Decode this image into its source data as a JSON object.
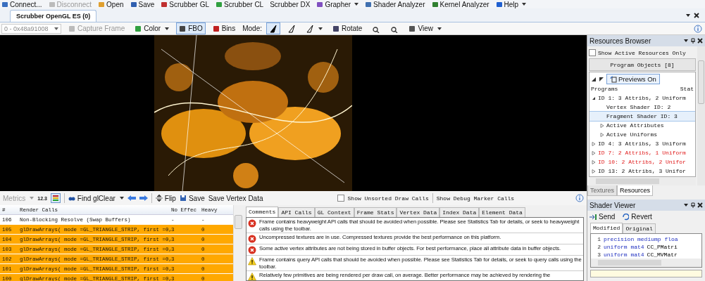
{
  "main_toolbar": [
    {
      "label": "Connect...",
      "disabled": false,
      "dropdown": false
    },
    {
      "label": "Disconnect",
      "disabled": true,
      "dropdown": false
    },
    {
      "label": "Open",
      "disabled": false,
      "dropdown": false
    },
    {
      "label": "Save",
      "disabled": false,
      "dropdown": false
    },
    {
      "label": "Scrubber GL",
      "disabled": false,
      "dropdown": false
    },
    {
      "label": "Scrubber CL",
      "disabled": false,
      "dropdown": false
    },
    {
      "label": "Scrubber DX",
      "disabled": false,
      "dropdown": false
    },
    {
      "label": "Grapher",
      "disabled": false,
      "dropdown": true
    },
    {
      "label": "Shader Analyzer",
      "disabled": false,
      "dropdown": false
    },
    {
      "label": "Kernel Analyzer",
      "disabled": false,
      "dropdown": false
    },
    {
      "label": "Help",
      "disabled": false,
      "dropdown": true
    }
  ],
  "document_tab": {
    "label": "Scrubber OpenGL ES (0)",
    "selected": true
  },
  "view_toolbar": {
    "frame": "0 - 0x48a91008",
    "items": [
      {
        "kind": "button",
        "label": "Capture Frame",
        "disabled": true,
        "pressed": false,
        "dropdown": false
      },
      {
        "kind": "button",
        "label": "Color",
        "disabled": false,
        "pressed": false,
        "dropdown": true
      },
      {
        "kind": "button",
        "label": "FBO",
        "disabled": false,
        "pressed": true,
        "dropdown": false
      },
      {
        "kind": "button",
        "label": "Bins",
        "disabled": false,
        "pressed": false,
        "dropdown": false
      },
      {
        "kind": "label",
        "label": "Mode:"
      },
      {
        "kind": "mode",
        "pressed": true,
        "dropdown": false
      },
      {
        "kind": "mode",
        "pressed": false,
        "dropdown": false
      },
      {
        "kind": "mode",
        "pressed": false,
        "dropdown": true
      },
      {
        "kind": "button",
        "label": "Rotate",
        "disabled": false,
        "pressed": false,
        "dropdown": false
      },
      {
        "kind": "zoom",
        "pressed": false
      },
      {
        "kind": "zoom",
        "pressed": false
      },
      {
        "kind": "button",
        "label": "View",
        "disabled": false,
        "pressed": false,
        "dropdown": true
      }
    ]
  },
  "resources_browser": {
    "title": "Resources Browser",
    "active_only": {
      "label": "Show Active Resources Only",
      "checked": false
    },
    "objects_button": "Program Objects [8]",
    "previews_button": {
      "label": "Previews On",
      "pressed": true
    },
    "columns": [
      "Programs",
      "Stat"
    ],
    "tree": [
      {
        "label": "ID 1: 3 Attribs, 2 Uniform",
        "error": false,
        "expanded": true,
        "selected": false,
        "children": [
          {
            "label": "Vertex Shader ID: 2",
            "selected": false
          },
          {
            "label": "Fragment Shader ID: 3",
            "selected": true
          },
          {
            "label": "Active Attributes",
            "expanded": false,
            "selected": false
          },
          {
            "label": "Active Uniforms",
            "expanded": false,
            "selected": false
          }
        ]
      },
      {
        "label": "ID 4: 3 Attribs, 3 Uniform",
        "error": false,
        "expanded": false,
        "selected": false
      },
      {
        "label": "ID 7: 2 Attribs, 1 Uniform",
        "error": true,
        "expanded": false,
        "selected": false
      },
      {
        "label": "ID 10: 2 Attribs, 2 Unifor",
        "error": true,
        "expanded": false,
        "selected": false
      },
      {
        "label": "ID 13: 2 Attribs, 3 Unifor",
        "error": false,
        "expanded": false,
        "selected": false
      }
    ],
    "tabs": [
      {
        "label": "Textures",
        "selected": false
      },
      {
        "label": "Resources",
        "selected": true
      }
    ]
  },
  "calls_toolbar": {
    "metrics": "Metrics",
    "metrics_value": "12.3",
    "find": "Find glClear",
    "flip": "Flip",
    "save": "Save",
    "save_vertex": "Save Vertex Data",
    "unsorted": {
      "label": "Show Unsorted Draw Calls",
      "checked": false
    },
    "debug_markers": "Show Debug Marker Calls"
  },
  "calls_table": {
    "columns": [
      "#",
      "Render Calls",
      "No Effec",
      "Heavy"
    ],
    "rows": [
      {
        "id": "106",
        "call": "Non-Blocking Resolve (Swap Buffers)",
        "no_effect": "-",
        "heavy": "-",
        "highlighted": false
      },
      {
        "id": "105",
        "call": "glDrawArrays( mode =GL_TRIANGLE_STRIP, first =0,",
        "no_effect": "3",
        "heavy": "0",
        "highlighted": true
      },
      {
        "id": "104",
        "call": "glDrawArrays( mode =GL_TRIANGLE_STRIP, first =0,",
        "no_effect": "3",
        "heavy": "0",
        "highlighted": true
      },
      {
        "id": "103",
        "call": "glDrawArrays( mode =GL_TRIANGLE_STRIP, first =0,",
        "no_effect": "3",
        "heavy": "0",
        "highlighted": true
      },
      {
        "id": "102",
        "call": "glDrawArrays( mode =GL_TRIANGLE_STRIP, first =0,",
        "no_effect": "3",
        "heavy": "0",
        "highlighted": true
      },
      {
        "id": "101",
        "call": "glDrawArrays( mode =GL_TRIANGLE_STRIP, first =0,",
        "no_effect": "3",
        "heavy": "0",
        "highlighted": true
      },
      {
        "id": "100",
        "call": "glDrawArrays( mode =GL_TRIANGLE_STRIP, first =0,",
        "no_effect": "3",
        "heavy": "0",
        "highlighted": true
      }
    ]
  },
  "detail_tabs": [
    {
      "label": "Comments",
      "selected": true
    },
    {
      "label": "API Calls",
      "selected": false
    },
    {
      "label": "GL Context",
      "selected": false
    },
    {
      "label": "Frame Stats",
      "selected": false
    },
    {
      "label": "Vertex Data",
      "selected": false
    },
    {
      "label": "Index Data",
      "selected": false
    },
    {
      "label": "Element Data",
      "selected": false
    }
  ],
  "comments": [
    {
      "kind": "error",
      "text": "Frame contains heavyweight API calls that should be avoided when possible.  Please see Statistics Tab for details, or seek to heavyweight calls using the toolbar."
    },
    {
      "kind": "error",
      "text": "Uncompressed textures are in use.  Compressed textures provide the best performance on this platform."
    },
    {
      "kind": "error",
      "text": "Some active vertex attributes are not being stored in buffer objects.  For best performance, place all attribute data in buffer objects."
    },
    {
      "kind": "warning",
      "text": "Frame contains query API calls that should be avoided when possible.  Please see Statistics Tab for details, or seek to query calls using the toolbar."
    },
    {
      "kind": "warning",
      "text": "Relatively few primitives are being rendered per draw call, on average.  Better performance may be achieved by rendering the"
    }
  ],
  "shader_viewer": {
    "title": "Shader Viewer",
    "send": "Send",
    "revert": "Revert",
    "tabs": [
      {
        "label": "Modified",
        "selected": true
      },
      {
        "label": "Original",
        "selected": false
      }
    ],
    "lines": [
      {
        "num": "1",
        "tokens": [
          {
            "kind": "keyword",
            "text": "precision mediump floa"
          }
        ]
      },
      {
        "num": "2",
        "tokens": [
          {
            "kind": "keyword",
            "text": "uniform mat4"
          },
          {
            "kind": "plain",
            "text": "CC_PMatri"
          }
        ]
      },
      {
        "num": "3",
        "tokens": [
          {
            "kind": "keyword",
            "text": "uniform mat4"
          },
          {
            "kind": "plain",
            "text": "CC_MVMatr"
          }
        ]
      }
    ]
  }
}
